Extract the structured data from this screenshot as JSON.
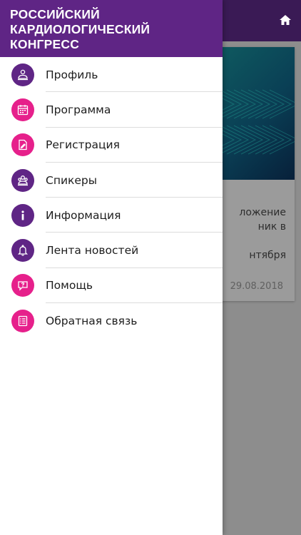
{
  "app": {
    "title_lines": [
      "РОССИЙСКИЙ",
      "КАРДИОЛОГИЧЕСКИЙ",
      "КОНГРЕСС"
    ],
    "accent_color": "#5f2585",
    "pink_color": "#e6208b"
  },
  "menu": {
    "items": [
      {
        "label": "Профиль",
        "icon": "profile-icon",
        "color": "purple"
      },
      {
        "label": "Программа",
        "icon": "calendar-icon",
        "color": "pink"
      },
      {
        "label": "Регистрация",
        "icon": "registration-icon",
        "color": "pink"
      },
      {
        "label": "Спикеры",
        "icon": "speakers-icon",
        "color": "purple"
      },
      {
        "label": "Информация",
        "icon": "info-icon",
        "color": "purple"
      },
      {
        "label": "Лента новостей",
        "icon": "bell-icon",
        "color": "purple"
      },
      {
        "label": "Помощь",
        "icon": "help-chat-icon",
        "color": "pink"
      },
      {
        "label": "Обратная связь",
        "icon": "feedback-icon",
        "color": "pink"
      }
    ]
  },
  "background": {
    "home_icon": "home-icon",
    "news_card": {
      "text_lines": [
        "ложение",
        "ник в",
        "",
        "нтября"
      ],
      "date": "29.08.2018"
    }
  }
}
